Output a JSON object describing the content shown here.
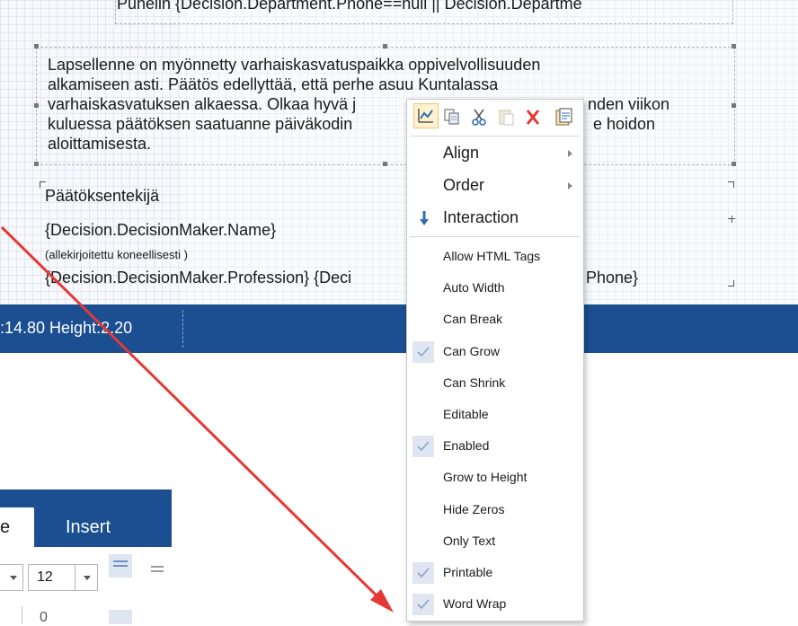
{
  "canvas": {
    "top_text": "Puhelin {Decision.Department.Phone==null || Decision.Departme",
    "paragraph": "Lapsellenne on myönnetty varhaiskasvatuspaikka oppivelvollisuuden alkamiseen asti. Päätös edellyttää, että perhe asuu Kuntalassa varhaiskasvatuksen alkaessa. Olkaa hyvä ja ilmoittakaa kahden viikon kuluessa päätöksen saatuanne päiväkodin johtajalle aikomuksenne hoidon aloittamisesta.",
    "para_lines": [
      "Lapsellenne on myönnetty varhaiskasvatuspaikka oppivelvollisuuden",
      "alkamiseen asti. Päätös edellyttää, että perhe asuu Kuntalassa",
      "varhaiskasvatuksen alkaessa. Olkaa hyvä j",
      "kuluessa päätöksen saatuanne päiväkodin",
      "aloittamisesta."
    ],
    "para_tail_line3": "nden viikon",
    "para_tail_line4": "e hoidon",
    "decision_maker_label": "Päätöksentekijä",
    "decision_maker_name": "{Decision.DecisionMaker.Name}",
    "signed_note": "(allekirjoitettu koneellisesti   )",
    "profession_line": "{Decision.DecisionMaker.Profession} {Deci",
    "profession_tail": "Phone}"
  },
  "statusbar": {
    "info": ":14.80 Height:2.20"
  },
  "ribbon": {
    "tab_active_label": "e",
    "tab_insert_label": "Insert",
    "font_size_value": "12",
    "second_row_text": "0"
  },
  "context_menu": {
    "toolbar_icons": [
      "chart-icon",
      "copy-icon",
      "cut-icon",
      "paste-icon",
      "delete-icon",
      "properties-icon"
    ],
    "items": [
      {
        "label": "Align",
        "submenu": true
      },
      {
        "label": "Order",
        "submenu": true
      },
      {
        "label": "Interaction",
        "icon": "interaction-down-arrow-icon"
      },
      {
        "label": "Allow HTML Tags",
        "checked": false
      },
      {
        "label": "Auto Width",
        "checked": false
      },
      {
        "label": "Can Break",
        "checked": false
      },
      {
        "label": "Can Grow",
        "checked": true
      },
      {
        "label": "Can Shrink",
        "checked": false
      },
      {
        "label": "Editable",
        "checked": false
      },
      {
        "label": "Enabled",
        "checked": true
      },
      {
        "label": "Grow to Height",
        "checked": false
      },
      {
        "label": "Hide Zeros",
        "checked": false
      },
      {
        "label": "Only Text",
        "checked": false
      },
      {
        "label": "Printable",
        "checked": true
      },
      {
        "label": "Word Wrap",
        "checked": true
      }
    ]
  },
  "colors": {
    "statusbar_bg": "#1b4f91",
    "annotation_arrow": "#e53935",
    "check_bg": "#dfe6f1",
    "check_mark": "#8aa4cc"
  }
}
